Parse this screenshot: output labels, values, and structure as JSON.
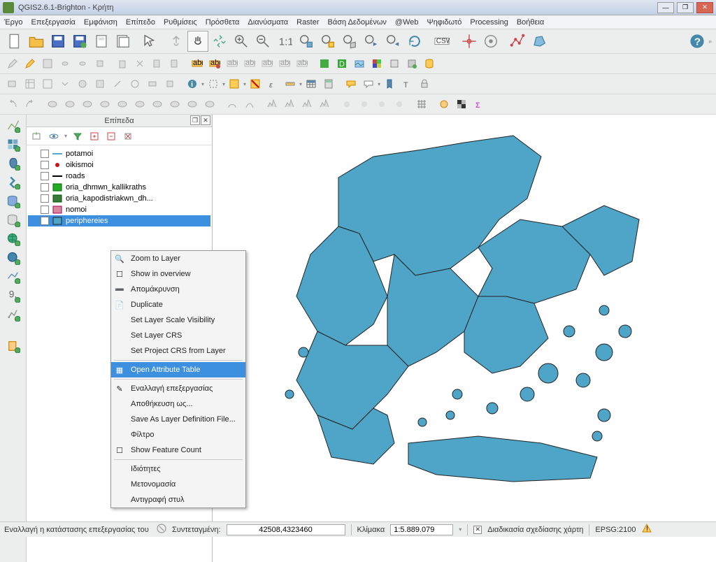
{
  "title": "QGIS2.6.1-Brighton - Κρήτη",
  "menu": [
    "Έργο",
    "Επεξεργασία",
    "Εμφάνιση",
    "Επίπεδο",
    "Ρυθμίσεις",
    "Πρόσθετα",
    "Διανύσματα",
    "Raster",
    "Βάση Δεδομένων",
    "@Web",
    "Ψηφιδωτό",
    "Processing",
    "Βοήθεια"
  ],
  "panel": {
    "title": "Επίπεδα",
    "layers": [
      {
        "name": "potamoi",
        "sym": "line-blue",
        "checked": false
      },
      {
        "name": "oikismoi",
        "sym": "dot-red",
        "checked": false
      },
      {
        "name": "roads",
        "sym": "line-black",
        "checked": false
      },
      {
        "name": "oria_dhmwn_kallikraths",
        "sym": "box-green",
        "checked": false
      },
      {
        "name": "oria_kapodistriakwn_dh...",
        "sym": "box-dgreen",
        "checked": false
      },
      {
        "name": "nomoi",
        "sym": "box-pink",
        "checked": false
      },
      {
        "name": "periphereies",
        "sym": "box-blue",
        "checked": true,
        "selected": true
      }
    ]
  },
  "ctx": {
    "items": [
      {
        "label": "Zoom to Layer",
        "icon": "zoom"
      },
      {
        "label": "Show in overview",
        "icon": "box"
      },
      {
        "label": "Απομάκρυνση",
        "icon": "remove"
      },
      {
        "label": "Duplicate",
        "icon": "dup"
      },
      {
        "label": "Set Layer Scale Visibility"
      },
      {
        "label": "Set Layer CRS"
      },
      {
        "label": "Set Project CRS from Layer"
      },
      {
        "sep": true
      },
      {
        "label": "Open Attribute Table",
        "icon": "table",
        "hl": true
      },
      {
        "sep": true
      },
      {
        "label": "Εναλλαγή επεξεργασίας",
        "icon": "pencil"
      },
      {
        "label": "Αποθήκευση ως..."
      },
      {
        "label": "Save As Layer Definition File..."
      },
      {
        "label": "Φίλτρο"
      },
      {
        "label": "Show Feature Count",
        "icon": "box"
      },
      {
        "sep": true
      },
      {
        "label": "Ιδιότητες"
      },
      {
        "label": "Μετονομασία"
      },
      {
        "label": "Αντιγραφή στυλ"
      }
    ]
  },
  "status": {
    "msg": "Εναλλαγή η κατάστασης επεξεργασίας του τρ",
    "coord_label": "Συντεταγμένη:",
    "coord": "42508,4323460",
    "scale_label": "Κλίμακα",
    "scale": "1:5.889.079",
    "render": "Διαδικασία σχεδίασης χάρτη",
    "crs": "EPSG:2100"
  },
  "icons": {
    "new": "📄",
    "open": "📂",
    "save": "💾",
    "saveas": "💾",
    "print": "🖨",
    "printcomp": "📰",
    "pan": "✋",
    "panto": "⤢",
    "zin": "🔍",
    "zout": "🔍",
    "zfull": "⛶",
    "zsel": "🔍",
    "zlay": "🔍",
    "zlast": "🔍",
    "znext": "🔍",
    "refresh": "🔄",
    "csw": "CSW",
    "identify": "ℹ",
    "zoomnative": "⬚",
    "select": "▭",
    "epsilon": "ε",
    "measure": "📏",
    "table": "▦",
    "calc": "🖩",
    "tip": "💬",
    "ann": "✎",
    "bm": "🔖",
    "text": "T"
  }
}
